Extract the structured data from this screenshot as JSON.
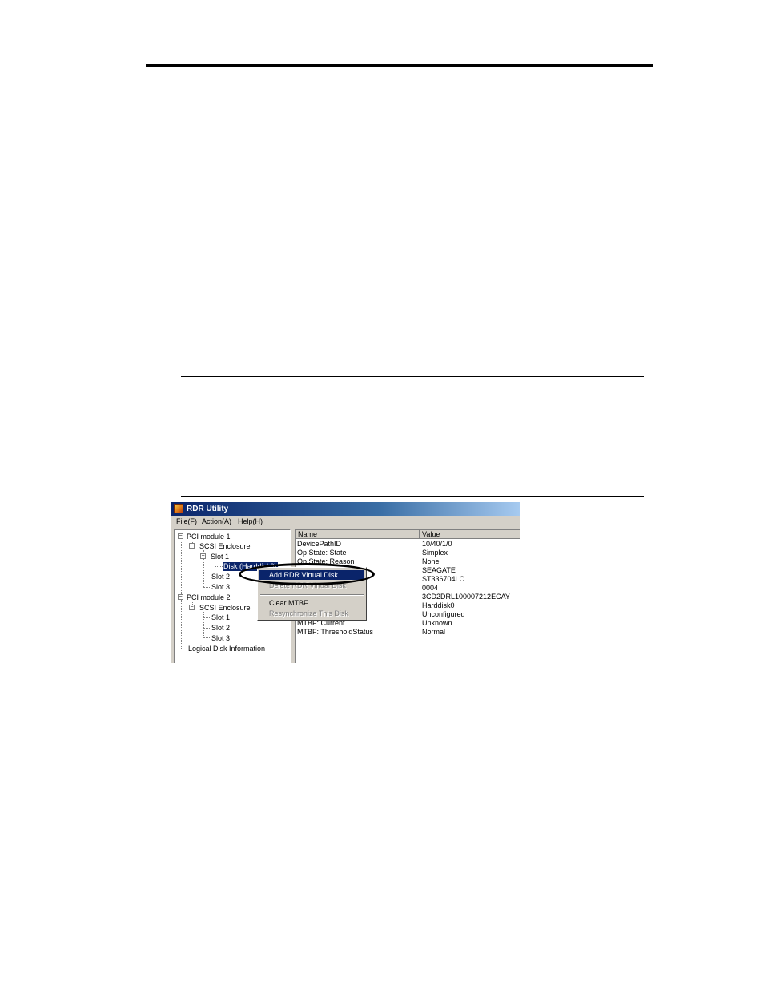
{
  "window": {
    "title": "RDR Utility"
  },
  "menu": {
    "items": [
      "File(F)",
      "Action(A)",
      "Help(H)"
    ]
  },
  "tree": {
    "nodes": [
      {
        "label": "PCI module 1",
        "expander": "−"
      },
      {
        "label": "SCSI Enclosure",
        "expander": "−"
      },
      {
        "label": "Slot 1",
        "expander": "−"
      },
      {
        "label": "Disk (Harddisk0)"
      },
      {
        "label": "Slot 2"
      },
      {
        "label": "Slot 3"
      },
      {
        "label": "PCI module 2",
        "expander": "−"
      },
      {
        "label": "SCSI Enclosure",
        "expander": "−"
      },
      {
        "label": "Slot 1"
      },
      {
        "label": "Slot 2"
      },
      {
        "label": "Slot 3"
      },
      {
        "label": "Logical Disk Information"
      }
    ]
  },
  "list": {
    "columns": [
      "Name",
      "Value"
    ],
    "rows": [
      {
        "name": "DevicePathID",
        "value": "10/40/1/0"
      },
      {
        "name": "Op State: State",
        "value": "Simplex"
      },
      {
        "name": "Op State: Reason",
        "value": "None"
      },
      {
        "name": "",
        "value": "SEAGATE"
      },
      {
        "name": "",
        "value": "ST336704LC"
      },
      {
        "name": "",
        "value": "0004"
      },
      {
        "name": "",
        "value": "3CD2DRL100007212ECAY"
      },
      {
        "name": "",
        "value": "Harddisk0"
      },
      {
        "name": "",
        "value": "Unconfigured"
      },
      {
        "name": "MTBF: Current",
        "value": "Unknown"
      },
      {
        "name": "MTBF: ThresholdStatus",
        "value": "Normal"
      }
    ]
  },
  "context_menu": {
    "items": [
      {
        "label": "Add RDR Virtual Disk",
        "state": "active"
      },
      {
        "label": "Delete RDR Virtual Disk",
        "state": "disabled"
      },
      {
        "label": "Clear MTBF",
        "state": "normal"
      },
      {
        "label": "Resynchronize This Disk",
        "state": "disabled"
      }
    ]
  },
  "colors": {
    "selection": "#0a246a",
    "face": "#d4d0c8",
    "title_start": "#0a246a"
  }
}
